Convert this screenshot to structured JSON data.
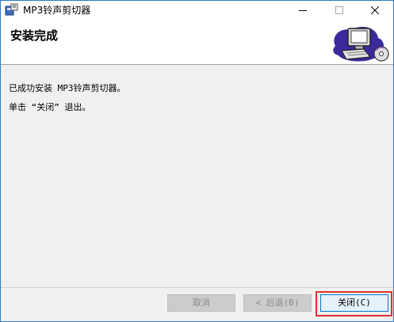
{
  "window": {
    "title": "MP3铃声剪切器",
    "controls": {
      "minimize": "minimize-icon",
      "maximize": "maximize-icon",
      "close": "close-icon"
    }
  },
  "banner": {
    "title": "安装完成",
    "art_icon": "computer-disc-icon"
  },
  "content": {
    "line1": "已成功安装 MP3铃声剪切器。",
    "line2": "单击 “关闭” 退出。"
  },
  "footer": {
    "cancel_label": "取消",
    "back_label": "< 后退(B)",
    "close_label": "关闭(C)"
  },
  "colors": {
    "window_border": "#2b78c5",
    "highlight": "#e03030",
    "disabled_button": "#cccccc"
  }
}
